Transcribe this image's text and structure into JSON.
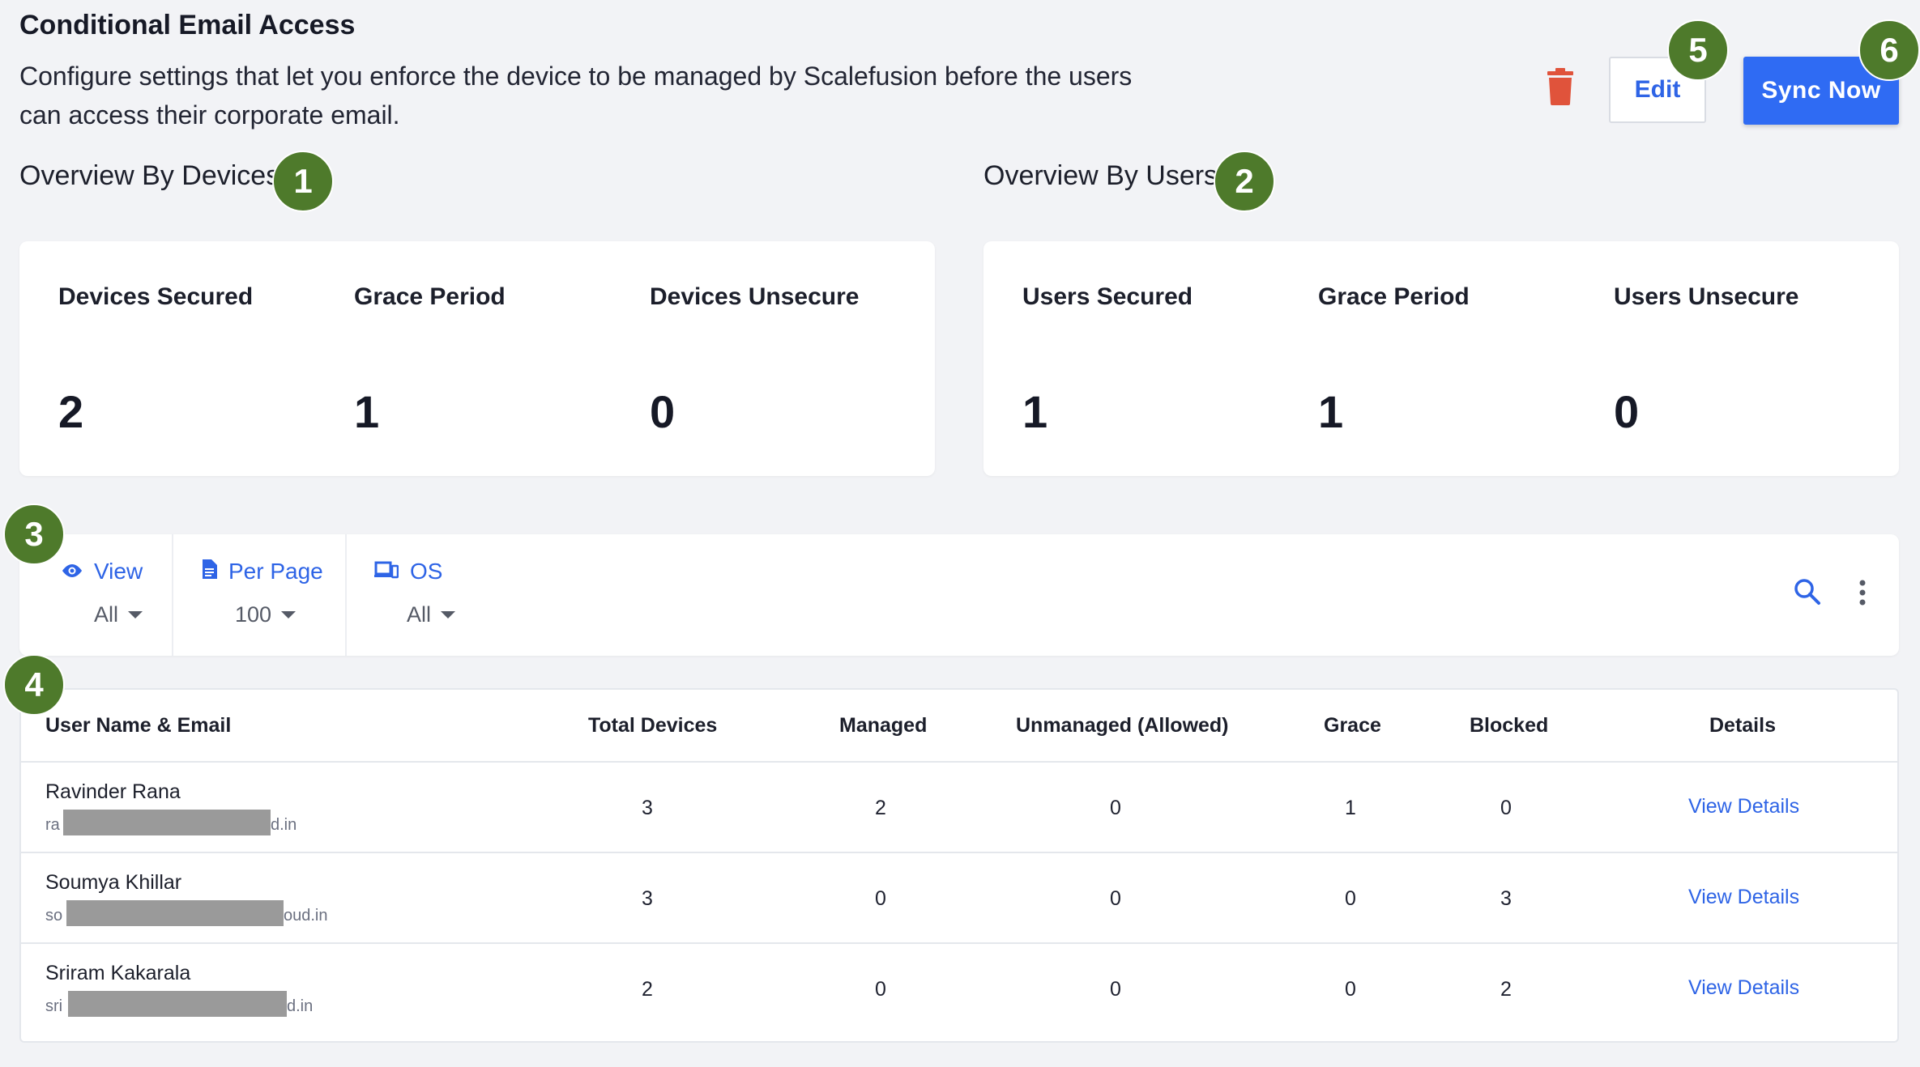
{
  "header": {
    "title": "Conditional Email Access",
    "description": "Configure settings that let you enforce the device to be managed by Scalefusion before the users can access their corporate email.",
    "edit_label": "Edit",
    "sync_label": "Sync Now"
  },
  "badges": [
    "1",
    "2",
    "3",
    "4",
    "5",
    "6"
  ],
  "devices_overview": {
    "title": "Overview By Devices",
    "stats": [
      {
        "label": "Devices Secured",
        "value": "2"
      },
      {
        "label": "Grace Period",
        "value": "1"
      },
      {
        "label": "Devices Unsecure",
        "value": "0"
      }
    ]
  },
  "users_overview": {
    "title": "Overview By Users",
    "stats": [
      {
        "label": "Users Secured",
        "value": "1"
      },
      {
        "label": "Grace Period",
        "value": "1"
      },
      {
        "label": "Users Unsecure",
        "value": "0"
      }
    ]
  },
  "filters": [
    {
      "label": "View",
      "value": "All",
      "icon": "eye-icon"
    },
    {
      "label": "Per Page",
      "value": "100",
      "icon": "document-icon"
    },
    {
      "label": "OS",
      "value": "All",
      "icon": "devices-icon"
    }
  ],
  "table": {
    "headers": [
      "User Name & Email",
      "Total Devices",
      "Managed",
      "Unmanaged (Allowed)",
      "Grace",
      "Blocked",
      "Details"
    ],
    "rows": [
      {
        "name": "Ravinder Rana",
        "email_start": "ra",
        "email_end": "d.in",
        "total": "3",
        "managed": "2",
        "unmanaged": "0",
        "grace": "1",
        "blocked": "0",
        "details": "View Details"
      },
      {
        "name": "Soumya Khillar",
        "email_start": "so",
        "email_end": "oud.in",
        "total": "3",
        "managed": "0",
        "unmanaged": "0",
        "grace": "0",
        "blocked": "3",
        "details": "View Details"
      },
      {
        "name": "Sriram Kakarala",
        "email_start": "sri",
        "email_end": "d.in",
        "total": "2",
        "managed": "0",
        "unmanaged": "0",
        "grace": "0",
        "blocked": "2",
        "details": "View Details"
      }
    ]
  },
  "colors": {
    "accent": "#2f6bf3",
    "badge": "#4e7a2b",
    "delete": "#e0533b"
  }
}
